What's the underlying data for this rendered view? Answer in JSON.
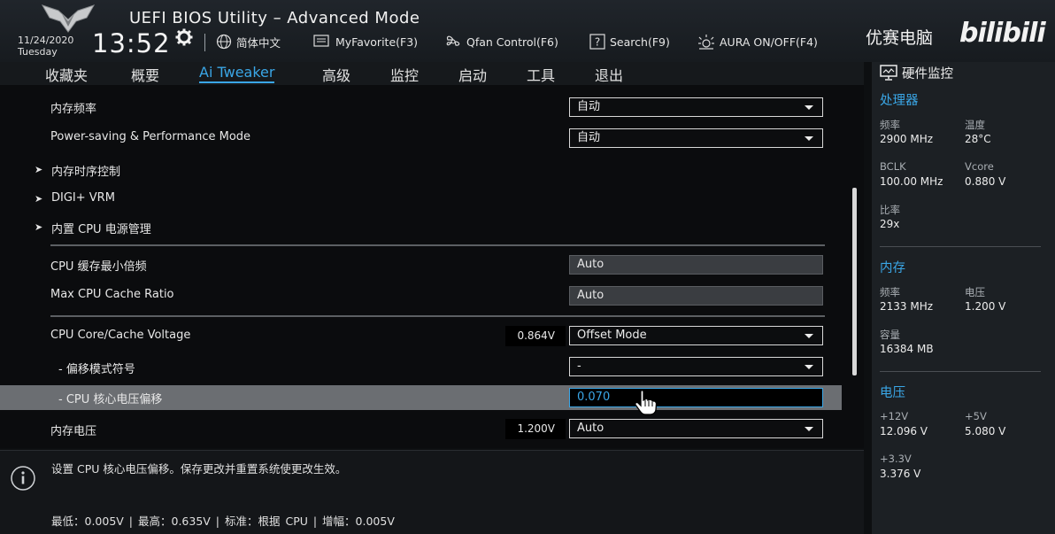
{
  "header": {
    "title": "UEFI BIOS Utility – Advanced Mode",
    "date": "11/24/2020",
    "day": "Tuesday",
    "time": "13:52",
    "buttons": [
      {
        "label": "简体中文",
        "icon": "globe-icon"
      },
      {
        "label": "MyFavorite(F3)",
        "icon": "favorite-icon"
      },
      {
        "label": "Qfan Control(F6)",
        "icon": "fan-icon"
      },
      {
        "label": "Search(F9)",
        "icon": "search-icon"
      },
      {
        "label": "AURA ON/OFF(F4)",
        "icon": "aura-icon"
      }
    ],
    "watermark": "优赛电脑",
    "bili_logo": "bilibili"
  },
  "menu": {
    "tabs": [
      "收藏夹",
      "概要",
      "Ai Tweaker",
      "高级",
      "监控",
      "启动",
      "工具",
      "退出"
    ],
    "active": "Ai Tweaker",
    "accent": "#3aa6e6"
  },
  "settings": {
    "memory_freq": {
      "label": "内存频率",
      "value": "自动"
    },
    "power_mode": {
      "label": "Power-saving & Performance Mode",
      "value": "自动"
    },
    "submenus": [
      "内存时序控制",
      "DIGI+ VRM",
      "内置 CPU 电源管理"
    ],
    "min_cache_ratio": {
      "label": "CPU 缓存最小倍频",
      "value": "Auto"
    },
    "max_cache_ratio": {
      "label": "Max CPU Cache Ratio",
      "value": "Auto"
    },
    "core_voltage": {
      "label": "CPU Core/Cache Voltage",
      "reading": "0.864V",
      "value": "Offset Mode"
    },
    "offset_sign": {
      "label": "- 偏移模式符号",
      "value": "-"
    },
    "offset_value": {
      "label": "- CPU 核心电压偏移",
      "value": "0.070"
    },
    "dram_voltage": {
      "label": "内存电压",
      "reading": "1.200V",
      "value": "Auto"
    }
  },
  "help": {
    "description": "设置 CPU 核心电压偏移。保存更改并重置系统使更改生效。",
    "range": "最低：0.005V  |  最高：0.635V  |  标准：根据 CPU  |  增幅：0.005V"
  },
  "hw_monitor": {
    "title": "硬件监控",
    "cpu": {
      "title": "处理器",
      "freq_label": "频率",
      "freq": "2900 MHz",
      "temp_label": "温度",
      "temp": "28°C",
      "bclk_label": "BCLK",
      "bclk": "100.00 MHz",
      "vcore_label": "Vcore",
      "vcore": "0.880 V",
      "ratio_label": "比率",
      "ratio": "29x"
    },
    "memory": {
      "title": "内存",
      "freq_label": "频率",
      "freq": "2133 MHz",
      "volt_label": "电压",
      "volt": "1.200 V",
      "cap_label": "容量",
      "cap": "16384 MB"
    },
    "voltage": {
      "title": "电压",
      "v12_label": "+12V",
      "v12": "12.096 V",
      "v5_label": "+5V",
      "v5": "5.080 V",
      "v33_label": "+3.3V",
      "v33": "3.376 V"
    }
  }
}
